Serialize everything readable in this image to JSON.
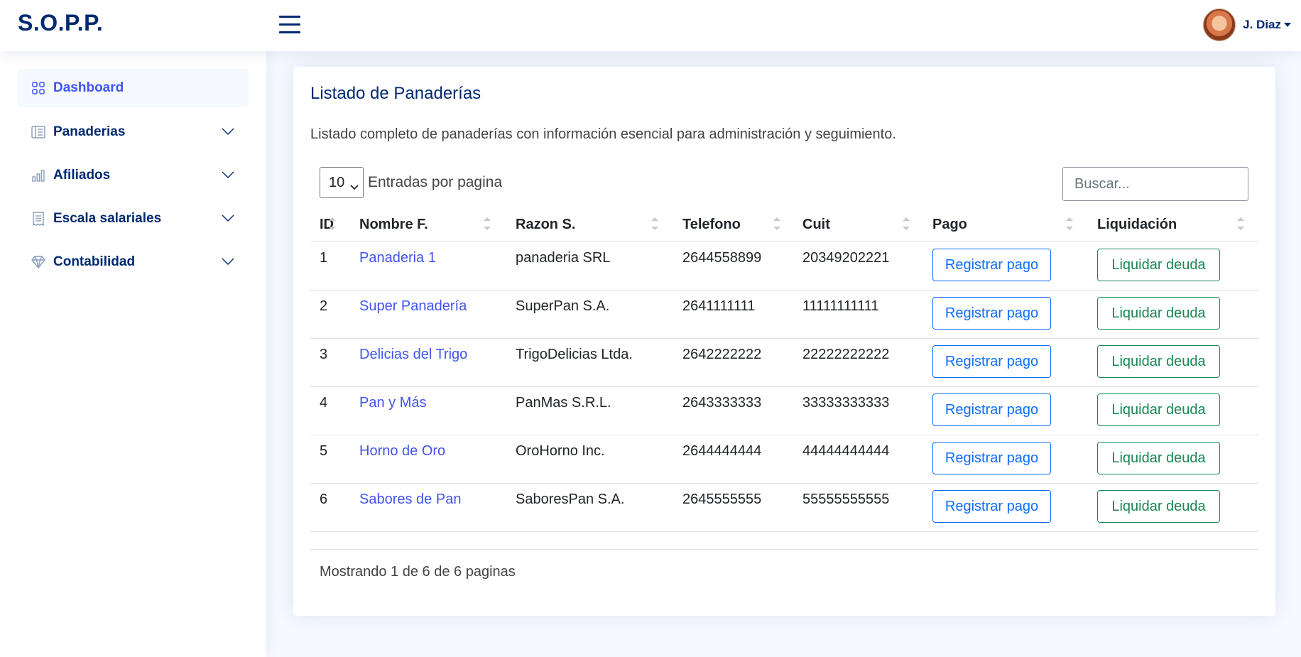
{
  "header": {
    "logo": "S.O.P.P.",
    "user_name": "J. Diaz"
  },
  "sidebar": {
    "items": [
      {
        "label": "Dashboard",
        "icon": "grid-icon",
        "active": true
      },
      {
        "label": "Panaderias",
        "icon": "menu-list-icon"
      },
      {
        "label": "Afiliados",
        "icon": "bar-chart-icon"
      },
      {
        "label": "Escala salariales",
        "icon": "receipt-icon"
      },
      {
        "label": "Contabilidad",
        "icon": "gem-icon"
      }
    ]
  },
  "card": {
    "title": "Listado de Panaderías",
    "description": "Listado completo de panaderías con información esencial para administración y seguimiento."
  },
  "table_controls": {
    "per_page_value": "10",
    "per_page_label": "Entradas por pagina",
    "search_placeholder": "Buscar..."
  },
  "table": {
    "columns": [
      "ID",
      "Nombre F.",
      "Razon S.",
      "Telefono",
      "Cuit",
      "Pago",
      "Liquidación"
    ],
    "rows": [
      {
        "id": "1",
        "nombre": "Panaderia 1",
        "razon": "panaderia SRL",
        "telefono": "2644558899",
        "cuit": "20349202221",
        "pago": "Registrar pago",
        "liquidacion": "Liquidar deuda"
      },
      {
        "id": "2",
        "nombre": "Super Panadería",
        "razon": "SuperPan S.A.",
        "telefono": "2641111111",
        "cuit": "11111111111",
        "pago": "Registrar pago",
        "liquidacion": "Liquidar deuda"
      },
      {
        "id": "3",
        "nombre": "Delicias del Trigo",
        "razon": "TrigoDelicias Ltda.",
        "telefono": "2642222222",
        "cuit": "22222222222",
        "pago": "Registrar pago",
        "liquidacion": "Liquidar deuda"
      },
      {
        "id": "4",
        "nombre": "Pan y Más",
        "razon": "PanMas S.R.L.",
        "telefono": "2643333333",
        "cuit": "33333333333",
        "pago": "Registrar pago",
        "liquidacion": "Liquidar deuda"
      },
      {
        "id": "5",
        "nombre": "Horno de Oro",
        "razon": "OroHorno Inc.",
        "telefono": "2644444444",
        "cuit": "44444444444",
        "pago": "Registrar pago",
        "liquidacion": "Liquidar deuda"
      },
      {
        "id": "6",
        "nombre": "Sabores de Pan",
        "razon": "SaboresPan S.A.",
        "telefono": "2645555555",
        "cuit": "55555555555",
        "pago": "Registrar pago",
        "liquidacion": "Liquidar deuda"
      }
    ]
  },
  "footer": {
    "info": "Mostrando 1 de 6 de 6 paginas"
  },
  "colors": {
    "primary": "#4154f1",
    "navy": "#012970",
    "button_blue": "#0d6efd",
    "button_green": "#198754",
    "background": "#f6f9ff"
  }
}
